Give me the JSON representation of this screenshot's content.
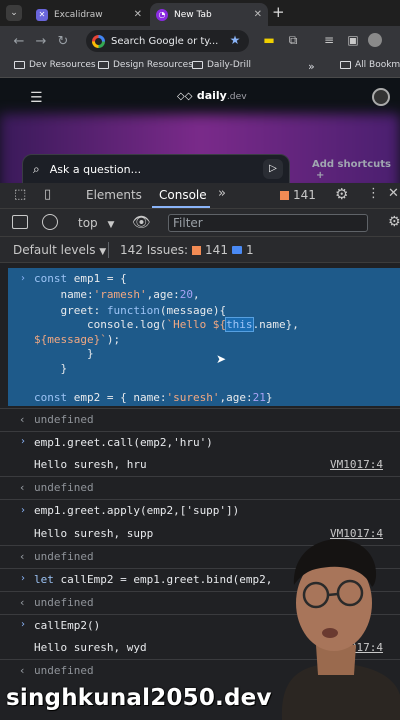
{
  "browser": {
    "tabs": [
      {
        "title": "Excalidraw",
        "active": false
      },
      {
        "title": "New Tab",
        "active": true
      }
    ],
    "new_tab_symbol": "+",
    "omnibox_placeholder": "Search Google or ty...",
    "bookmarks": [
      "Dev Resources",
      "Design Resources",
      "Daily-Drill"
    ],
    "bookmarks_overflow": "»",
    "all_bookmarks": "All Bookmarks"
  },
  "page": {
    "logo_text": "daily",
    "logo_suffix": ".dev",
    "ask_placeholder": "Ask a question...",
    "add_shortcuts": "Add shortcuts"
  },
  "devtools": {
    "tabs": [
      "Elements",
      "Console"
    ],
    "active_tab": "Console",
    "more": "»",
    "issues_count": "141",
    "context": "top",
    "filter_placeholder": "Filter",
    "default_levels": "Default levels",
    "issues_label": "142 Issues:",
    "issues_warn": "141",
    "issues_info": "1"
  },
  "console": {
    "undefined_label": "undefined",
    "entries": [
      {
        "input": "emp1.greet.call(emp2,'hru')",
        "output": "Hello suresh, hru",
        "source": "VM1017:4"
      },
      {
        "input": "emp1.greet.apply(emp2,['supp'])",
        "output": "Hello suresh, supp",
        "source": "VM1017:4"
      },
      {
        "input": "let callEmp2 = emp1.greet.bind(emp2,",
        "output": "",
        "source": ""
      },
      {
        "input": "callEmp2()",
        "output": "Hello suresh, wyd",
        "source": "VM1017:4"
      }
    ]
  },
  "colors": {
    "console_bg": "#202124",
    "selection": "#1e5a8a",
    "keyword": "#9cc3f5",
    "string": "#f2a882",
    "number": "#a8a3f5"
  },
  "watermark": "singhkunal2050.dev"
}
